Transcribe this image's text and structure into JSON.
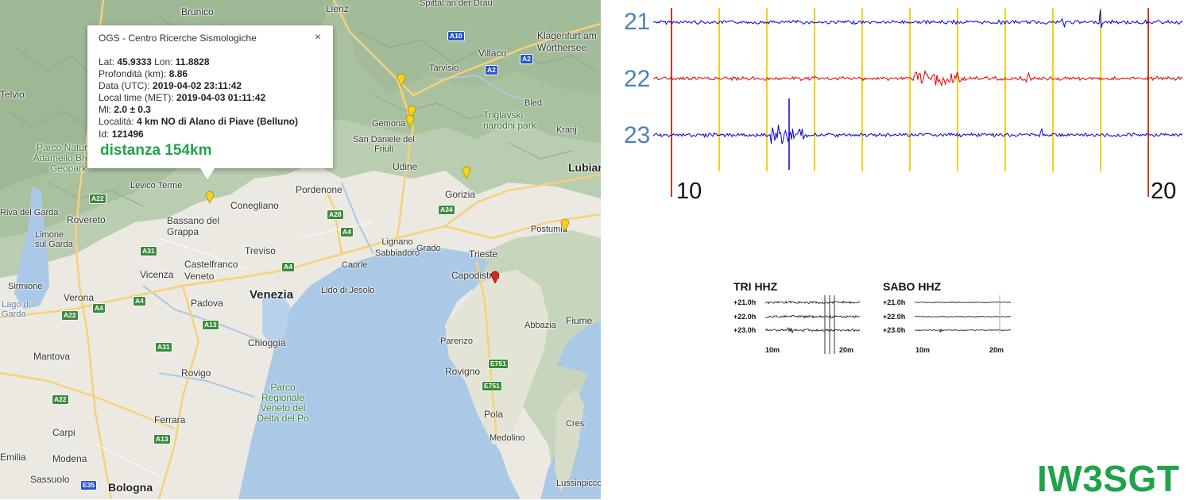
{
  "map": {
    "places": {
      "bolzano_area": "Brunico",
      "spittal": "Spittal an der Drau",
      "lienz": "Lienz",
      "klagenfurt": "Klagenfurt am Wörthersee",
      "villaco": "Villaco",
      "arvisio": "Tarvisio",
      "bled": "Bled",
      "triglav": "Triglavski narodni park",
      "kranj": "Kranj",
      "lubiana": "Lubian",
      "gemona": "Gemona",
      "sandaniele": "San Daniele del Friuli",
      "udine": "Udine",
      "gorizia": "Gorizia",
      "postumia": "Postumia",
      "pordenone": "Pordenone",
      "conegliano": "Conegliano",
      "bassano": "Bassano del Grappa",
      "levico": "Levico Terme",
      "rovereto": "Rovereto",
      "parco_adamello": "Parco Naturale Adamello Brenta Geopark",
      "riva": "Riva del Garda",
      "limone": "Limone sul Garda",
      "sirmione": "Sirmione",
      "garda": "Lago di Garda",
      "verona": "Verona",
      "vicenza": "Vicenza",
      "castelfranco": "Castelfranco Veneto",
      "treviso": "Treviso",
      "padova": "Padova",
      "venezia": "Venezia",
      "lido": "Lido di Jesolo",
      "lignano": "Lignano Sabbiadoro",
      "caorle": "Caorle",
      "grado": "Grado",
      "trieste": "Trieste",
      "capodistria": "Capodistria",
      "chioggia": "Chioggia",
      "rovigo": "Rovigo",
      "mantova": "Mantova",
      "parco_delta": "Parco Regionale Veneto del Delta del Po",
      "ferrara": "Ferrara",
      "carpi": "Carpi",
      "emilia": "Emilia",
      "modena": "Modena",
      "sassuolo": "Sassuolo",
      "bologna": "Bologna",
      "parenzo": "Parenzo",
      "rovigno": "Rovigno",
      "pola": "Pola",
      "medolino": "Medolino",
      "abbazia": "Abbazia",
      "fiume": "Fiume",
      "cres": "Cres",
      "lussinpiccolo": "Lussinpiccolo",
      "telvio": "Telvio"
    },
    "roads": [
      "A10",
      "A2",
      "A2",
      "A22",
      "A28",
      "A4",
      "A34",
      "A31",
      "A4",
      "A4",
      "A22",
      "A13",
      "A31",
      "A22",
      "A13",
      "E751",
      "E751",
      "E35",
      "A4"
    ]
  },
  "popup": {
    "title": "OGS - Centro Ricerche Sismologiche",
    "close": "×",
    "lat_label": "Lat:",
    "lat": "45.9333",
    "lon_label": "Lon:",
    "lon": "11.8828",
    "depth_label": "Profondità (km):",
    "depth": "8.86",
    "utc_label": "Data (UTC):",
    "utc": "2019-04-02 23:11:42",
    "met_label": "Local time (MET):",
    "met": "2019-04-03 01:11:42",
    "ml_label": "Ml:",
    "ml": "2.0 ± 0.3",
    "loc_label": "Località:",
    "loc": "4 km NO di Alano di Piave (Belluno)",
    "id_label": "Id:",
    "id": "121496",
    "distance": "distanza 154km"
  },
  "seismo": {
    "hours": [
      "21",
      "22",
      "23"
    ],
    "tick_start": "10",
    "tick_end": "20",
    "trace_colors": [
      "#0000dd",
      "#e00000",
      "#0000dd"
    ],
    "line_yellow": "#f2d21a",
    "line_red": "#d23a1a"
  },
  "thumbs": [
    {
      "title": "TRI HHZ",
      "rows": [
        "+21.0h",
        "+22.0h",
        "+23.0h"
      ],
      "ticks": [
        "10m",
        "20m"
      ]
    },
    {
      "title": "SABO HHZ",
      "rows": [
        "+21.0h",
        "+22.0h",
        "+23.0h"
      ],
      "ticks": [
        "10m",
        "20m"
      ]
    }
  ],
  "brand": "IW3SGT"
}
